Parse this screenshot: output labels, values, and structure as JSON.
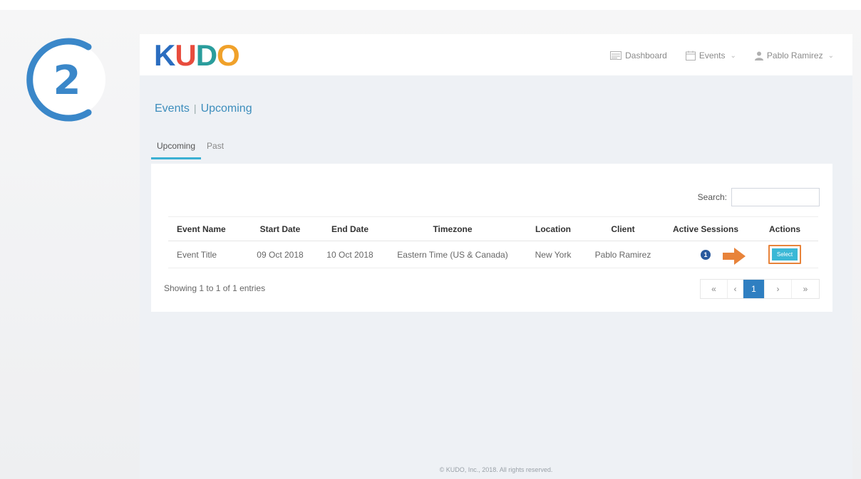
{
  "step": {
    "number": "2",
    "color": "#3a87c9"
  },
  "brand": {
    "logo_letters": [
      {
        "char": "K",
        "color": "#2a6dc0"
      },
      {
        "char": "U",
        "color": "#e84c3d"
      },
      {
        "char": "D",
        "color": "#2a9d9c"
      },
      {
        "char": "O",
        "color": "#f0a12a"
      }
    ]
  },
  "nav": {
    "dashboard_label": "Dashboard",
    "events_label": "Events",
    "user_label": "Pablo Ramirez"
  },
  "breadcrumb": {
    "section": "Events",
    "separator": "|",
    "page": "Upcoming"
  },
  "tabs": [
    {
      "label": "Upcoming",
      "active": true
    },
    {
      "label": "Past",
      "active": false
    }
  ],
  "search": {
    "label": "Search:",
    "value": ""
  },
  "table": {
    "columns": [
      "Event Name",
      "Start Date",
      "End Date",
      "Timezone",
      "Location",
      "Client",
      "Active Sessions",
      "Actions"
    ],
    "rows": [
      {
        "event_name": "Event Title",
        "start_date": "09 Oct 2018",
        "end_date": "10 Oct 2018",
        "timezone": "Eastern Time (US & Canada)",
        "location": "New York",
        "client": "Pablo Ramirez",
        "active_sessions": "1",
        "action_label": "Select"
      }
    ]
  },
  "entries_info": "Showing 1 to 1 of 1 entries",
  "pagination": {
    "first": "«",
    "prev": "‹",
    "current": "1",
    "next": "›",
    "last": "»"
  },
  "footer": "© KUDO, Inc., 2018. All rights reserved.",
  "colors": {
    "accent": "#3bb8d6",
    "highlight": "#e8833a",
    "primary": "#2f7fc1"
  }
}
